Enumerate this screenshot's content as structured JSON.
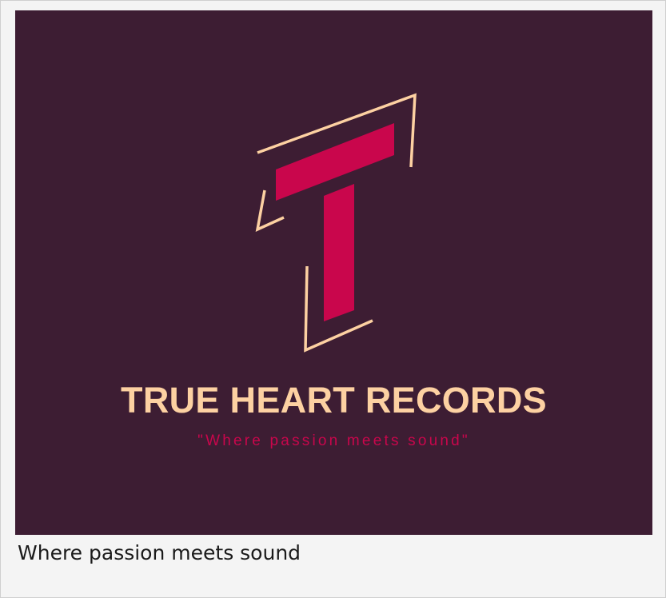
{
  "logo": {
    "brand_name": "TRUE HEART RECORDS",
    "tagline": "\"Where passion meets sound\"",
    "monogram": "T",
    "colors": {
      "background": "#3d1d33",
      "monogram_fill": "#c9064c",
      "outline": "#fdd1a2",
      "brand_text": "#fdd1a2",
      "tagline_text": "#c9064c"
    }
  },
  "caption": {
    "text": "Where passion meets sound"
  }
}
